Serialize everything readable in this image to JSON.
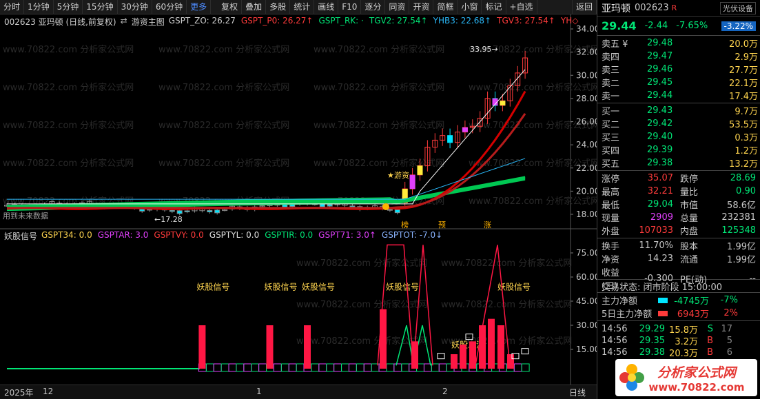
{
  "toolbar": {
    "left": [
      "分时",
      "1分钟",
      "5分钟",
      "15分钟",
      "30分钟",
      "60分钟"
    ],
    "more": "更多",
    "right": [
      "复权",
      "叠加",
      "多股",
      "统计",
      "画线",
      "F10",
      "逐分",
      "同资",
      "开资",
      "简框",
      "小窗",
      "标记",
      "+自选"
    ],
    "back": "返回"
  },
  "main_info": {
    "code_title": "002623 亚玛顿 (日线,前复权)",
    "indicator_icon": "swap-icon",
    "indicator_name": "游资主图",
    "items": [
      {
        "label": "GSPT_ZO: 26.27",
        "color": "#d0d0d0"
      },
      {
        "label": "GSPT_P0: 26.27↑",
        "color": "#ff3b3b"
      },
      {
        "label": "GSPT_RK: ·",
        "color": "#00e676"
      },
      {
        "label": "TGV2: 27.54↑",
        "color": "#00e676"
      },
      {
        "label": "YHB3: 22.68↑",
        "color": "#29b6f6"
      },
      {
        "label": "TGV3: 27.54↑",
        "color": "#ff3b3b"
      },
      {
        "label": "YH◇",
        "color": "#ff3b3b"
      }
    ]
  },
  "sub_info": {
    "name": "妖股信号",
    "items": [
      {
        "label": "GSPT34: 0.0",
        "color": "#ffd54f"
      },
      {
        "label": "GSPTAR: 3.0",
        "color": "#e040fb"
      },
      {
        "label": "GSPTVY: 0.0",
        "color": "#ff3b3b"
      },
      {
        "label": "GSPTYL: 0.0",
        "color": "#e0e0e0"
      },
      {
        "label": "GSPTIR: 0.0",
        "color": "#00e676"
      },
      {
        "label": "GSPT71: 3.0↑",
        "color": "#e040fb"
      },
      {
        "label": "GSPTOT: -7.0↓",
        "color": "#8ab4ff"
      }
    ]
  },
  "main_yaxis": [
    "34.00",
    "32.00",
    "30.00",
    "28.00",
    "26.00",
    "24.00",
    "22.00",
    "20.00",
    "18.00"
  ],
  "sub_yaxis": [
    "75.00",
    "60.00",
    "45.00",
    "30.00",
    "15.00"
  ],
  "annotations": {
    "high": "33.95",
    "low": "←17.28",
    "future": "用到未来数据",
    "yousi": "★游资",
    "bang": "榜",
    "yu": "预",
    "zhang": "涨",
    "signal": "妖股信号",
    "second_wave": "妖股二波"
  },
  "xaxis": {
    "year": "2025年",
    "m12": "12",
    "m1": "1",
    "m2": "2",
    "period": "日线"
  },
  "watermark_text": "www.70822.com 分析家公式网",
  "chart_data": [
    {
      "type": "candlestick",
      "title": "",
      "ylim": [
        17,
        34.5
      ],
      "yticks": [
        34,
        32,
        30,
        28,
        26,
        24,
        22,
        20,
        18
      ],
      "series": [
        {
          "name": "GSPT_ZO",
          "color": "#d0d0d0",
          "last": 26.27
        },
        {
          "name": "GSPT_P0",
          "color": "#ff3b3b",
          "last": 26.27
        },
        {
          "name": "TGV2",
          "color": "#00e676",
          "last": 27.54
        },
        {
          "name": "YHB3",
          "color": "#29b6f6",
          "last": 22.68
        },
        {
          "name": "TGV3",
          "color": "#ff3b3b",
          "last": 27.54
        }
      ],
      "annotations": {
        "high": 33.95,
        "low": 17.28
      }
    },
    {
      "type": "bar",
      "title": "",
      "ylim": [
        0,
        80
      ],
      "yticks": [
        75,
        60,
        45,
        30,
        15
      ],
      "series": [
        {
          "name": "GSPT34",
          "last": 0.0
        },
        {
          "name": "GSPTAR",
          "last": 3.0
        },
        {
          "name": "GSPTVY",
          "last": 0.0
        },
        {
          "name": "GSPTYL",
          "last": 0.0
        },
        {
          "name": "GSPTIR",
          "last": 0.0
        },
        {
          "name": "GSPT71",
          "last": 3.0
        },
        {
          "name": "GSPTOT",
          "last": -7.0
        }
      ]
    }
  ],
  "stock": {
    "name": "亚玛顿",
    "code": "002623",
    "r_badge": "R",
    "industry": "光伏设备",
    "price": "29.44",
    "change": "-2.44",
    "pct": "-7.65%",
    "badge": "-3.22%"
  },
  "orderbook": {
    "asks": [
      {
        "label": "卖五 ¥",
        "price": "29.48",
        "qty": "20.0万"
      },
      {
        "label": "卖四",
        "price": "29.47",
        "qty": "2.9万"
      },
      {
        "label": "卖三",
        "price": "29.46",
        "qty": "27.7万"
      },
      {
        "label": "卖二",
        "price": "29.45",
        "qty": "22.1万"
      },
      {
        "label": "卖一",
        "price": "29.44",
        "qty": "17.4万"
      }
    ],
    "bids": [
      {
        "label": "买一",
        "price": "29.43",
        "qty": "9.7万"
      },
      {
        "label": "买二",
        "price": "29.42",
        "qty": "53.5万"
      },
      {
        "label": "买三",
        "price": "29.40",
        "qty": "0.3万"
      },
      {
        "label": "买四",
        "price": "29.39",
        "qty": "1.2万"
      },
      {
        "label": "买五",
        "price": "29.38",
        "qty": "13.2万"
      }
    ]
  },
  "stats": [
    [
      {
        "l": "涨停",
        "v": "35.07",
        "c": "#ff3b3b"
      },
      {
        "l": "跌停",
        "v": "28.69",
        "c": "#00e676"
      }
    ],
    [
      {
        "l": "最高",
        "v": "32.21",
        "c": "#ff3b3b"
      },
      {
        "l": "量比",
        "v": "0.90",
        "c": "#00e676"
      }
    ],
    [
      {
        "l": "最低",
        "v": "29.04",
        "c": "#00e676"
      },
      {
        "l": "市值",
        "v": "58.6亿",
        "c": "#c8c8c8"
      }
    ],
    [
      {
        "l": "现量",
        "v": "2909",
        "c": "#e040fb"
      },
      {
        "l": "总量",
        "v": "232381",
        "c": "#c8c8c8"
      }
    ],
    [
      {
        "l": "外盘",
        "v": "107033",
        "c": "#ff3b3b"
      },
      {
        "l": "内盘",
        "v": "125348",
        "c": "#00e676"
      }
    ]
  ],
  "stats2": [
    [
      {
        "l": "换手",
        "v": "11.70%",
        "c": "#c8c8c8"
      },
      {
        "l": "股本",
        "v": "1.99亿",
        "c": "#c8c8c8"
      }
    ],
    [
      {
        "l": "净资",
        "v": "14.23",
        "c": "#c8c8c8"
      },
      {
        "l": "流通",
        "v": "1.99亿",
        "c": "#c8c8c8"
      }
    ],
    [
      {
        "l": "收益(三)",
        "v": "-0.300",
        "c": "#c8c8c8"
      },
      {
        "l": "PE(动)",
        "v": "--",
        "c": "#c8c8c8"
      }
    ]
  ],
  "trade_state": "交易状态: 闭市阶段 15:00:00",
  "flows": [
    {
      "label": "主力净额",
      "bar_color": "#00e5ff",
      "value": "-4745万",
      "pct": "-7%",
      "color": "#00e676"
    },
    {
      "label": "5日主力净额",
      "bar_color": "#ff3b3b",
      "value": "6943万",
      "pct": "2%",
      "color": "#ff3b3b"
    }
  ],
  "ticks": [
    {
      "t": "14:56",
      "p": "29.29",
      "vol": "15.8万",
      "bs": "S",
      "n": "17",
      "pc": "#00e676",
      "bc": "#00e676"
    },
    {
      "t": "14:56",
      "p": "29.35",
      "vol": "3.2万",
      "bs": "B",
      "n": "5",
      "pc": "#00e676",
      "bc": "#ff3b3b"
    },
    {
      "t": "14:56",
      "p": "29.38",
      "vol": "20.3万",
      "bs": "B",
      "n": "6",
      "pc": "#00e676",
      "bc": "#ff3b3b"
    }
  ],
  "watermark": {
    "line1": "分析家公式网",
    "line2": "www.70822.com"
  }
}
